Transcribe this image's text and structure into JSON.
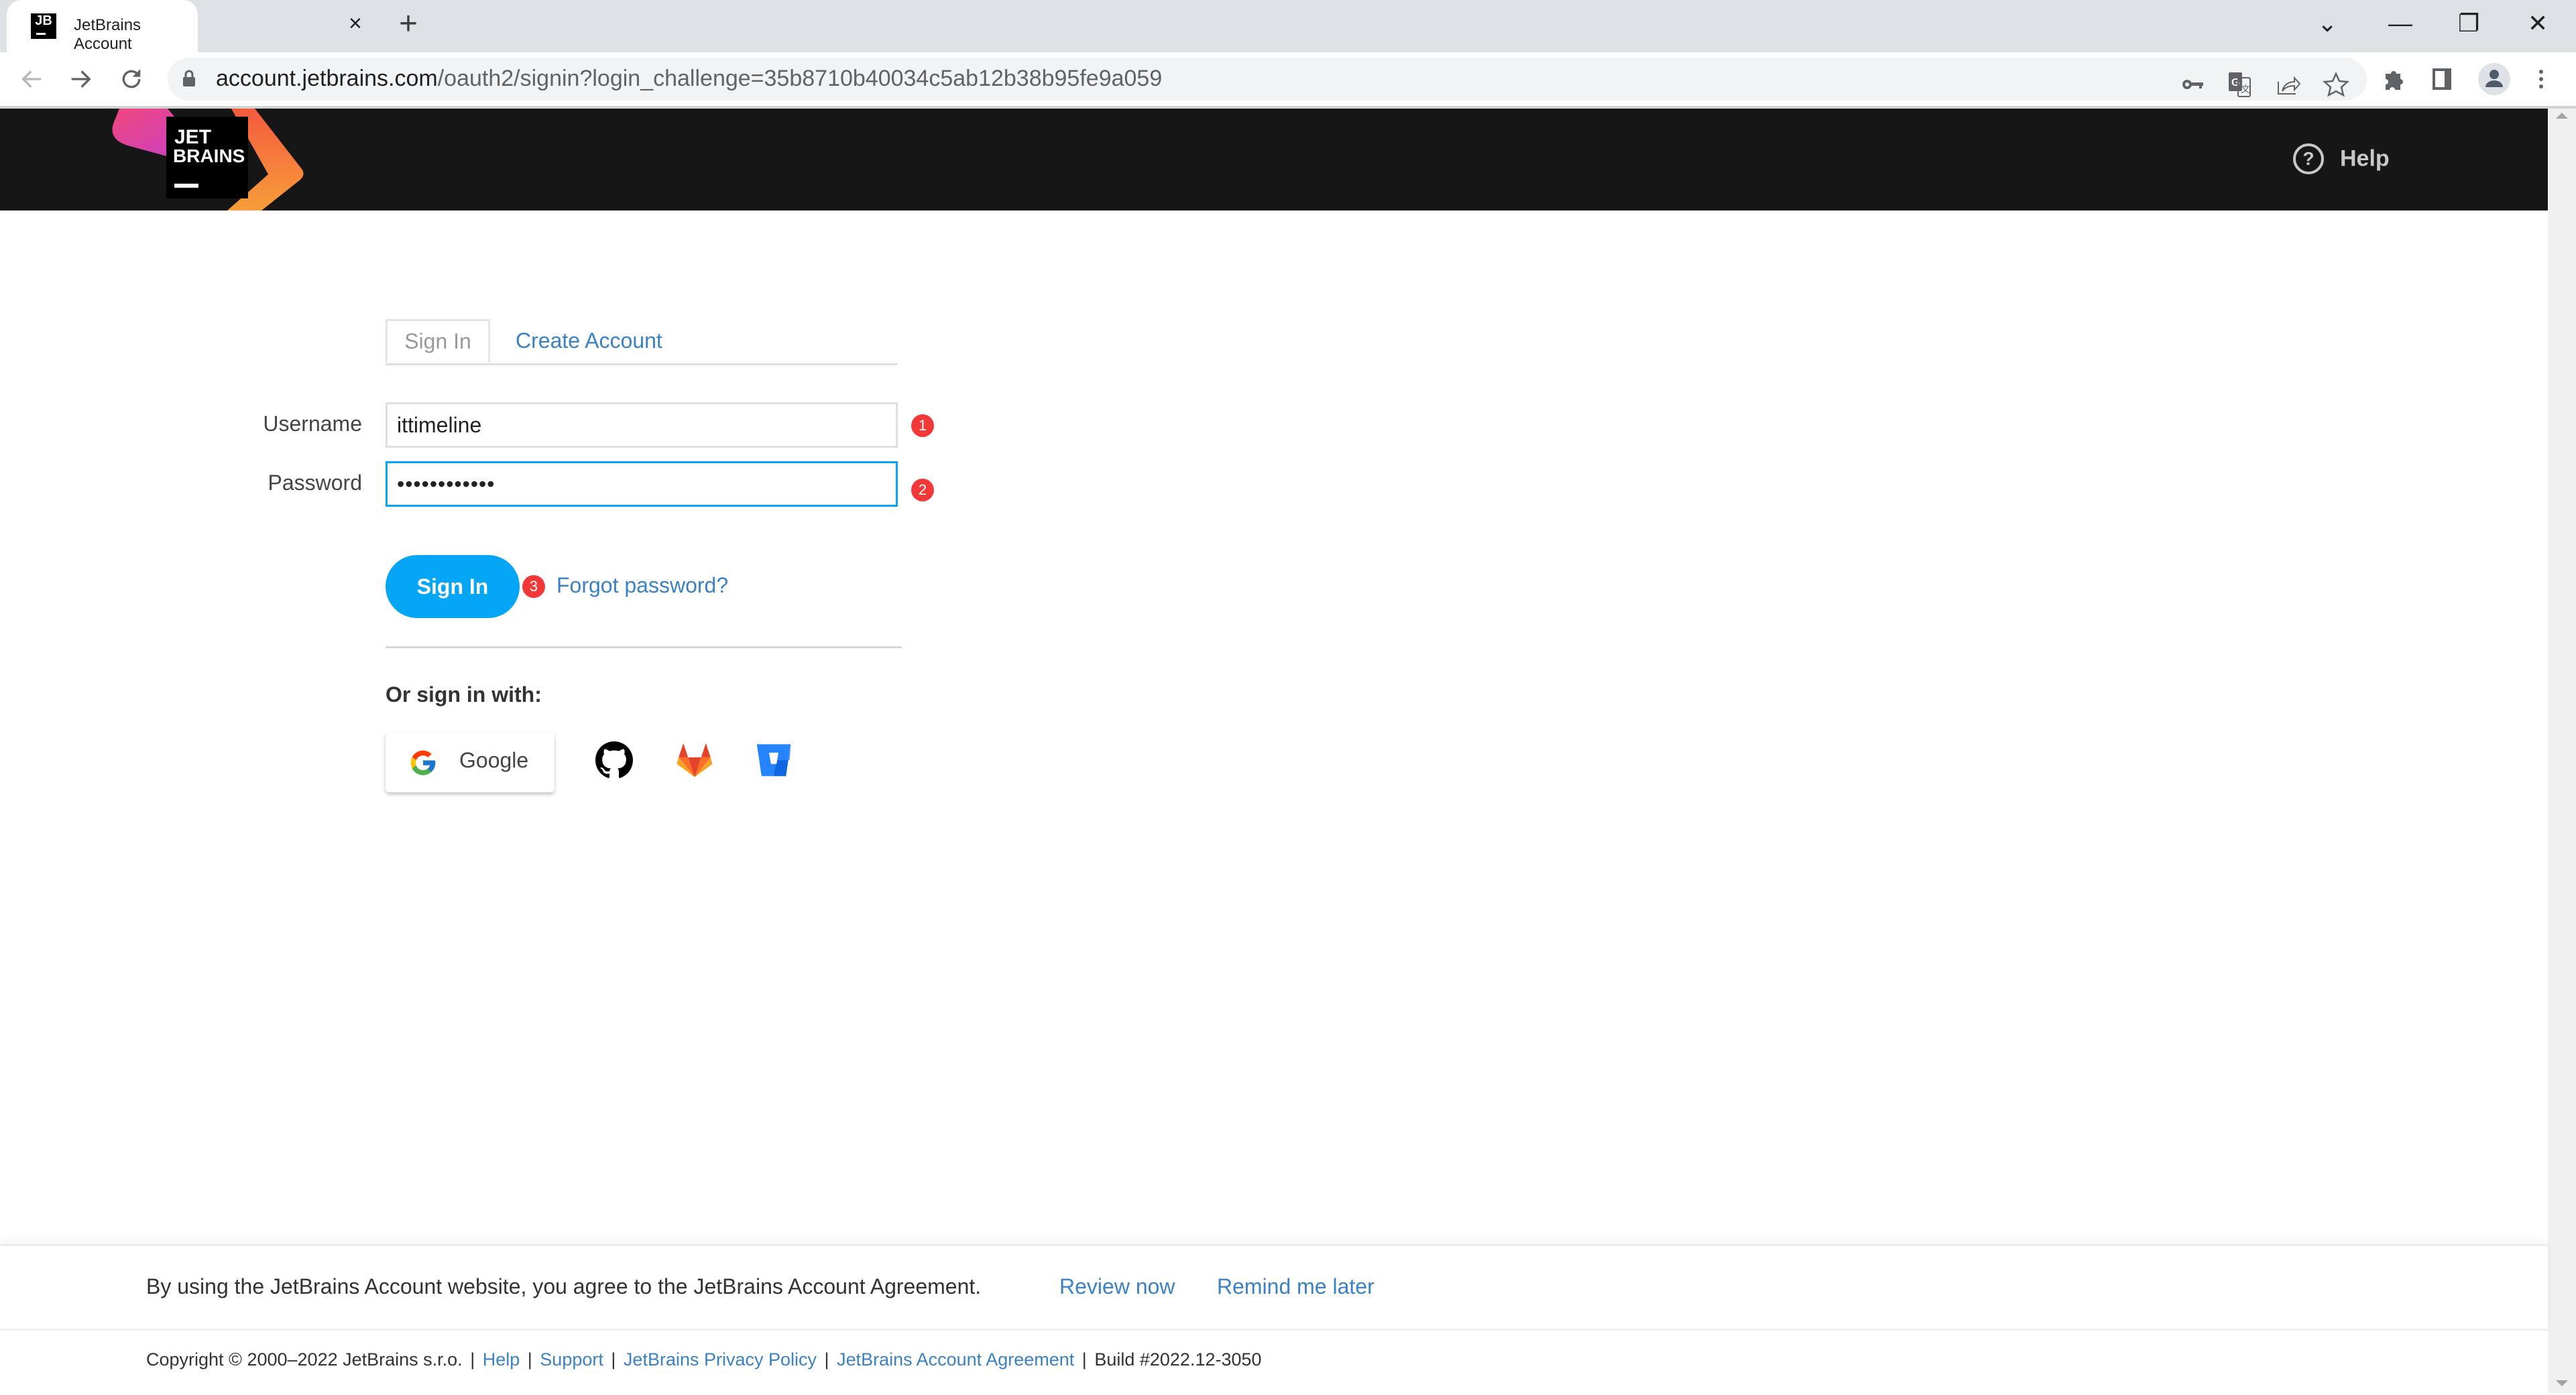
{
  "browser": {
    "tab_title": "JetBrains Account",
    "tab_favicon_text": "JB",
    "close_tab_glyph": "×",
    "new_tab_glyph": "+",
    "window_controls": {
      "tab_search": "⌄",
      "minimize": "—",
      "restore": "❐",
      "close": "✕"
    },
    "url_host": "account.jetbrains.com",
    "url_path": "/oauth2/signin?login_challenge=35b8710b40034c5ab12b38b95fe9a059",
    "icons": [
      "back-icon",
      "forward-icon",
      "reload-icon",
      "lock-icon",
      "key-icon",
      "translate-icon",
      "share-icon",
      "bookmark-star-icon",
      "extensions-icon",
      "side-panel-icon",
      "profile-icon",
      "menu-icon"
    ]
  },
  "header": {
    "logo_text_line1": "JET",
    "logo_text_line2": "BRAINS",
    "help_label": "Help",
    "help_glyph": "?"
  },
  "form": {
    "tabs": [
      {
        "label": "Sign In",
        "active": true
      },
      {
        "label": "Create Account",
        "active": false
      }
    ],
    "username_label": "Username",
    "username_value": "ittimeline",
    "password_label": "Password",
    "password_value": "••••••••••••",
    "badges": [
      "1",
      "2",
      "3"
    ],
    "sign_in_button": "Sign In",
    "forgot_password": "Forgot password?",
    "or_sign_in_with": "Or sign in with:",
    "google_label": "Google",
    "social_providers": [
      "GitHub",
      "GitLab",
      "Bitbucket"
    ]
  },
  "agreement": {
    "text": "By using the JetBrains Account website, you agree to the JetBrains Account Agreement.",
    "review_now": "Review now",
    "remind_later": "Remind me later"
  },
  "footer": {
    "copyright": "Copyright © 2000–2022 JetBrains s.r.o.",
    "links": [
      "Help",
      "Support",
      "JetBrains Privacy Policy",
      "JetBrains Account Agreement"
    ],
    "build": "Build #2022.12-3050"
  },
  "colors": {
    "accent": "#05a6f5",
    "link": "#3a82c4",
    "badge": "#f23838",
    "header_bg": "#161616"
  }
}
